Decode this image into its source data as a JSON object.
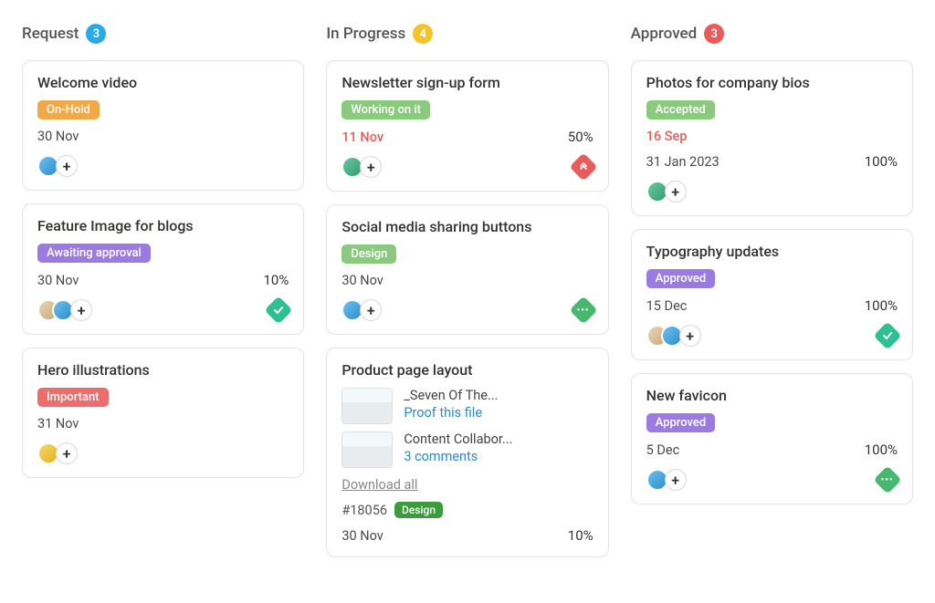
{
  "columns": [
    {
      "title": "Request",
      "count": "3",
      "countClass": "count-blue"
    },
    {
      "title": "In Progress",
      "count": "4",
      "countClass": "count-yellow"
    },
    {
      "title": "Approved",
      "count": "3",
      "countClass": "count-red"
    }
  ],
  "request": [
    {
      "title": "Welcome video",
      "tag": {
        "label": "On-Hold",
        "cls": "tag-orange"
      },
      "date": "30 Nov"
    },
    {
      "title": "Feature Image for blogs",
      "tag": {
        "label": "Awaiting approval",
        "cls": "tag-purple"
      },
      "date": "30 Nov",
      "pct": "10%",
      "priority": "teal-check"
    },
    {
      "title": "Hero illustrations",
      "tag": {
        "label": "Important",
        "cls": "tag-red"
      },
      "date": "31 Nov"
    }
  ],
  "inprogress": [
    {
      "title": "Newsletter sign-up form",
      "tag": {
        "label": "Working on it",
        "cls": "tag-lgreen"
      },
      "date": "11 Nov",
      "dateRed": true,
      "pct": "50%",
      "priority": "red-up"
    },
    {
      "title": "Social media sharing buttons",
      "tag": {
        "label": "Design",
        "cls": "tag-lgreen"
      },
      "date": "30 Nov",
      "priority": "green-dots"
    },
    {
      "title": "Product page layout",
      "attachments": [
        {
          "name": "_Seven Of The...",
          "link": "Proof this file"
        },
        {
          "name": "Content Collabor...",
          "link": "3 comments"
        }
      ],
      "download": "Download all",
      "id": "#18056",
      "idTag": {
        "label": "Design",
        "cls": "tag-dgreen"
      },
      "date": "30 Nov",
      "pct": "10%"
    }
  ],
  "approved": [
    {
      "title": "Photos for company bios",
      "tag": {
        "label": "Accepted",
        "cls": "tag-lgreen"
      },
      "dateRed": "16 Sep",
      "date": "31 Jan 2023",
      "pct": "100%"
    },
    {
      "title": "Typography updates",
      "tag": {
        "label": "Approved",
        "cls": "tag-purple"
      },
      "date": "15 Dec",
      "pct": "100%",
      "priority": "teal-check"
    },
    {
      "title": "New favicon",
      "tag": {
        "label": "Approved",
        "cls": "tag-purple"
      },
      "date": "5 Dec",
      "pct": "100%",
      "priority": "green-dots"
    }
  ]
}
